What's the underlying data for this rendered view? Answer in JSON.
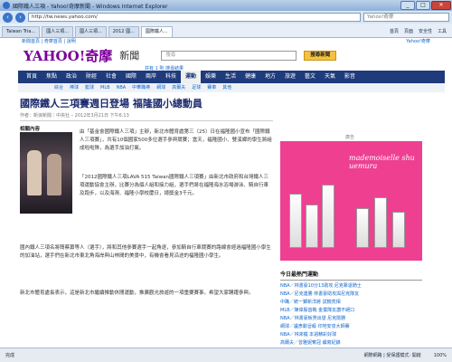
{
  "window": {
    "title": "國際鐵人三項 - Yahoo!奇摩新聞 - Windows Internet Explorer",
    "minimize": "_",
    "maximize": "□",
    "close": "✕"
  },
  "address": {
    "url": "http://tw.news.yahoo.com/",
    "search_placeholder": "Yahoo!奇摩"
  },
  "tabs": [
    {
      "label": "Taiwan Tria..."
    },
    {
      "label": "國人三項..."
    },
    {
      "label": "國人三項..."
    },
    {
      "label": "2012 國..."
    },
    {
      "label": "國際鐵人..."
    }
  ],
  "tab_tools": [
    "首頁",
    "頁面",
    "安全性",
    "工具"
  ],
  "page": {
    "util_left": "新聞首頁 | 奇摩首頁 | 說明",
    "util_right": "Yahoo!奇摩",
    "logo": "YAHOO!奇摩",
    "section": "新聞",
    "search_placeholder": "搜尋",
    "search_button": "搜尋新聞",
    "crumb": "共有 1 則 搜尋結果",
    "nav": [
      "首頁",
      "焦點",
      "政治",
      "財經",
      "社會",
      "國際",
      "兩岸",
      "科技",
      "運動",
      "娛樂",
      "生活",
      "健康",
      "地方",
      "旅遊",
      "藝文",
      "天氣",
      "影音"
    ],
    "nav_active_index": 8,
    "subnav": [
      "綜合",
      "棒球",
      "籃球",
      "MLB",
      "NBA",
      "中華職棒",
      "網球",
      "高爾夫",
      "足球",
      "賽車",
      "其他"
    ]
  },
  "article": {
    "headline": "國際鐵人三項賽週日登場 福隆國小總動員",
    "byline": "作者：新浪新聞｜中央社 – 2012年3月21日 下午6:13",
    "photo_label": "相關內容",
    "para1": "由「基金會國際鐵人三項」主辦，新北市體育處第三（25）日在福隆國小宣布「國際鐵人三項賽」，共有10個國家500多位選手參與競賽；當天，福隆國小、雙溪鄉的學生將組成啦啦隊，為選手加油打氣。",
    "para2": "「2012國際鐵人三項LAVA 515 Taiwan國際鐵人三項賽」由新北市政府和台灣鐵人三項運動協會主辦，比賽分為個人組和接力組，選手們將在福隆海水浴場游泳、騎自行車及跑步，以及海灣、福隆小學校慶日，總獎金3千元。",
    "para3": "國內鐵人三項名將簡蔡蕭等人（選手），將和其他參賽選手一起角逐，參加騎自行車競賽的路線會經過福隆國小學生的加油站，選手們在新北市東北角海岸與山林間的美景中，有機會看見沿途的福隆國小學生。",
    "para4": "新北市體育處長表示，這是新北市繼續推動休閒運動，推廣觀光旅遊的一項重要賽事，希望大家踴躍參與。"
  },
  "ad": {
    "label": "廣告",
    "text": "mademoiselle shu uemura"
  },
  "sidebar": {
    "heading": "今日最熱門運動",
    "items": [
      "NBA／林書豪10分13助攻 尼克擊退騎士",
      "NBA／尼克連勝 林書豪助攻與尼克隊友",
      "中職／統一獅新洋將 試鏡亮相",
      "MLB／陳偉殷首戰 金鶯隊友讚不絕口",
      "NBA／林書豪板凳出發 尼克險勝",
      "網球／盧彥勳晉級 印地安泉大師賽",
      "NBA／林來瘋 本週精彩好球",
      "高爾夫／曾雅妮奪冠 續寫紀錄"
    ]
  },
  "status": {
    "left": "完成",
    "zone": "網際網路 | 受保護模式: 開啟",
    "zoom": "100%"
  },
  "colors": {
    "accent": "#1f3b7c",
    "brand": "#7b0099",
    "link": "#1166cc",
    "ad_bg": "#ee3f91"
  }
}
